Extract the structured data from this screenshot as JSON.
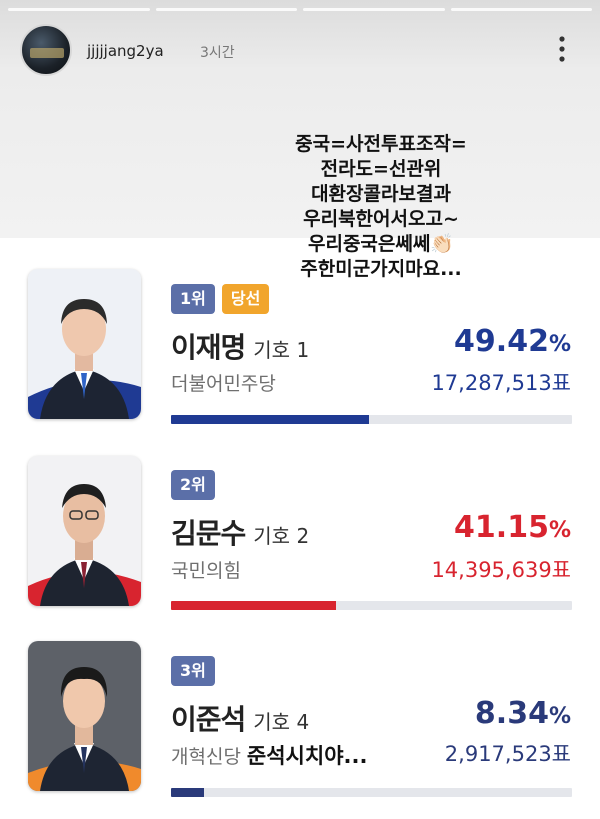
{
  "story": {
    "username": "jjjjjang2ya",
    "time": "3시간",
    "overlay_lines": [
      "중국=사전투표조작=",
      "전라도=선관위",
      "대환장콜라보결과",
      "우리북한어서오고~",
      "우리중국은쎄쎄👏🏻",
      "주한미군가지마요..."
    ]
  },
  "candidates": [
    {
      "rank": "1위",
      "status": "당선",
      "name": "이재명",
      "ballot": "기호 1",
      "party": "더불어민주당",
      "party_note": "",
      "percent": "49.42",
      "percent_unit": "%",
      "votes": "17,287,513표",
      "share": 0.4942,
      "color": "#1f3a93",
      "tie_color": "#2f63c6",
      "suit_color": "#1d2433"
    },
    {
      "rank": "2위",
      "status": "",
      "name": "김문수",
      "ballot": "기호 2",
      "party": "국민의힘",
      "party_note": "",
      "percent": "41.15",
      "percent_unit": "%",
      "votes": "14,395,639표",
      "share": 0.4115,
      "color": "#d8242f",
      "tie_color": "#8a2233",
      "suit_color": "#1e2430"
    },
    {
      "rank": "3위",
      "status": "",
      "name": "이준석",
      "ballot": "기호 4",
      "party": "개혁신당",
      "party_note": "준석시치야...",
      "percent": "8.34",
      "percent_unit": "%",
      "votes": "2,917,523표",
      "share": 0.0834,
      "color": "#2a3a7a",
      "tie_color": "#25345f",
      "suit_color": "#1e2533"
    }
  ]
}
